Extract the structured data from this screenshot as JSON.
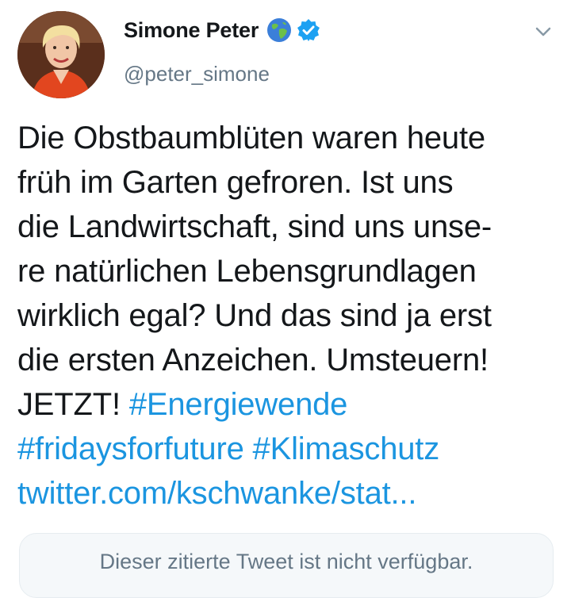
{
  "author": {
    "name": "Simone Peter",
    "handle": "@peter_simone"
  },
  "icons": {
    "globe": "globe-emoji-icon",
    "verified": "verified-badge-icon",
    "menu": "chevron-down-icon"
  },
  "colors": {
    "link": "#1b95e0",
    "verified": "#1da1f2",
    "secondary_text": "#657786"
  },
  "tweet": {
    "lines": [
      "Die Obstbaumblüten waren heute",
      "früh im Garten gefroren. Ist uns",
      "die Landwirtschaft, sind uns unse-",
      "re natürlichen Lebensgrundlagen",
      "wirklich egal? Und das sind ja erst",
      "die ersten Anzeichen. Umsteuern!"
    ],
    "last_line_text": "JETZT!",
    "hashtags": [
      "#Energiewende",
      "#fridaysforfuture",
      "#Klimaschutz"
    ],
    "link": "twitter.com/kschwanke/stat..."
  },
  "quote_card": {
    "text": "Dieser zitierte Tweet ist nicht verfügbar."
  }
}
